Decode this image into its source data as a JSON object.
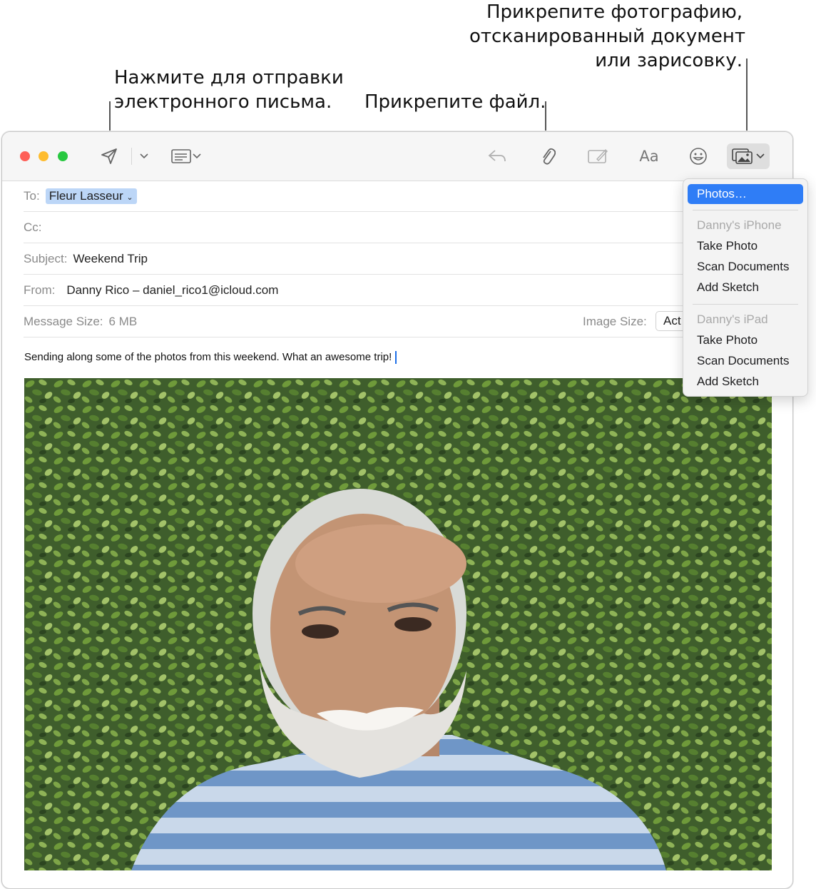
{
  "callouts": {
    "send": "Нажмите для отправки\nэлектронного письма.",
    "attach_file": "Прикрепите файл.",
    "attach_photo": "Прикрепите фотографию,\nотсканированный документ\nили зарисовку."
  },
  "colors": {
    "close": "#fe5f57",
    "minimize": "#febc2e",
    "zoom": "#28c840",
    "accent": "#2f7df6"
  },
  "toolbar": {
    "send_icon": "paper-plane-icon",
    "format_label": "Aa"
  },
  "header": {
    "to_label": "To:",
    "to_value": "Fleur Lasseur",
    "cc_label": "Cc:",
    "subject_label": "Subject:",
    "subject_value": "Weekend Trip",
    "from_label": "From:",
    "from_value": "Danny Rico – daniel_rico1@icloud.com",
    "size_label": "Message Size:",
    "size_value": "6 MB",
    "image_size_label": "Image Size:",
    "image_size_value": "Act"
  },
  "body": {
    "text": "Sending along some of the photos from this weekend. What an awesome trip!"
  },
  "menu": {
    "photos": "Photos…",
    "iphone_header": "Danny's iPhone",
    "iphone_take_photo": "Take Photo",
    "iphone_scan": "Scan Documents",
    "iphone_sketch": "Add Sketch",
    "ipad_header": "Danny's iPad",
    "ipad_take_photo": "Take Photo",
    "ipad_scan": "Scan Documents",
    "ipad_sketch": "Add Sketch"
  }
}
